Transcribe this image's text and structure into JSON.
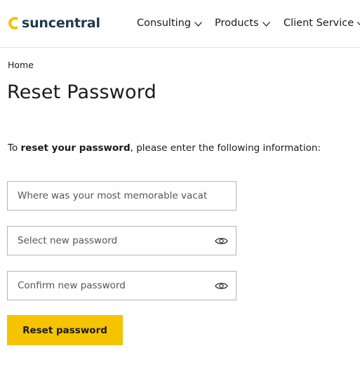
{
  "brand": {
    "name": "suncentral",
    "accent": "#f5c400",
    "text_color": "#1f3a4d"
  },
  "nav": {
    "items": [
      {
        "label": "Consulting",
        "icon": "chevron-down-icon"
      },
      {
        "label": "Products",
        "icon": "chevron-down-icon"
      },
      {
        "label": "Client Service",
        "icon": "chevron-down-icon"
      }
    ]
  },
  "breadcrumb": {
    "home": "Home"
  },
  "page": {
    "title": "Reset Password",
    "intro_prefix": "To ",
    "intro_bold": "reset your password",
    "intro_suffix": ", please enter the following information:"
  },
  "form": {
    "security_question": {
      "placeholder": "Where was your most memorable vacation?",
      "value": ""
    },
    "new_password": {
      "placeholder": "Select new password",
      "value": "",
      "icon": "eye-icon"
    },
    "confirm_password": {
      "placeholder": "Confirm new password",
      "value": "",
      "icon": "eye-icon"
    },
    "submit_label": "Reset password"
  }
}
